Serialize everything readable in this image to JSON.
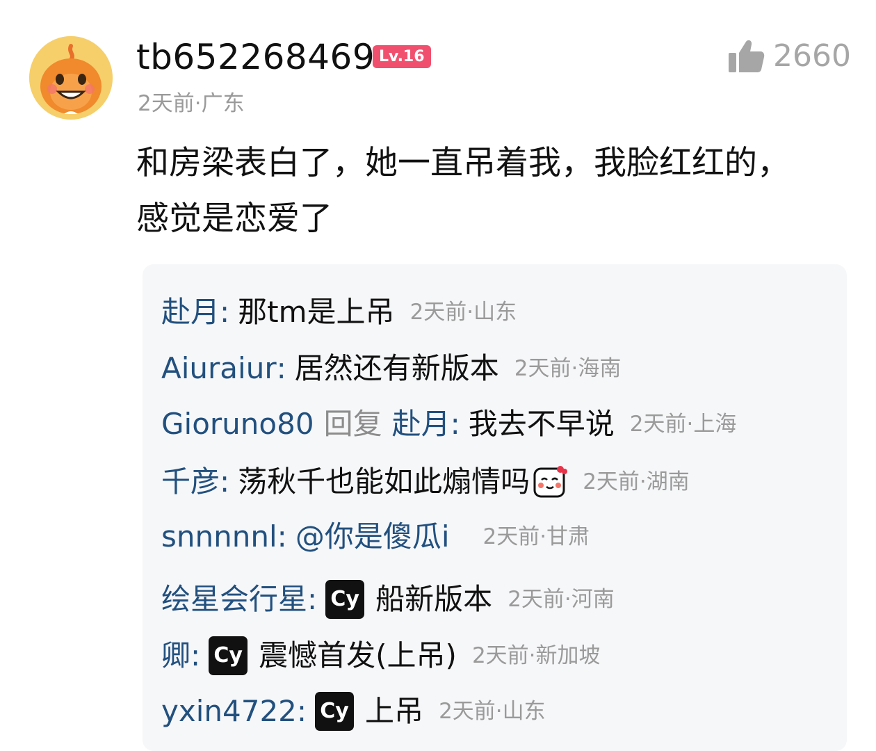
{
  "post": {
    "username": "tb652268469",
    "level": "Lv.16",
    "likes": "2660",
    "meta": "2天前·广东",
    "text": "和房梁表白了，她一直吊着我，我脸红红的，感觉是恋爱了"
  },
  "replies": [
    {
      "author": "赴月",
      "sep": ":",
      "content": "那tm是上吊",
      "meta": "2天前·山东"
    },
    {
      "author": "Aiuraiur",
      "sep": ":",
      "content": "居然还有新版本",
      "meta": "2天前·海南"
    },
    {
      "author": "Gioruno80",
      "reply_word": "回复",
      "target": "赴月",
      "sep": ":",
      "content": "我去不早说",
      "meta": "2天前·上海"
    },
    {
      "author": "千彦",
      "sep": ":",
      "content": "荡秋千也能如此煽情吗",
      "emoji": "blushing-face-icon",
      "meta": "2天前·湖南"
    },
    {
      "author": "snnnnnl",
      "sep": ":",
      "content": "@你是傻瓜i",
      "meta": "2天前·甘肃"
    },
    {
      "author": "绘星会行星",
      "sep": ":",
      "badge": "Cy",
      "content": "船新版本",
      "meta": "2天前·河南"
    },
    {
      "author": "卿",
      "sep": ":",
      "badge": "Cy",
      "content": "震憾首发(上吊)",
      "meta": "2天前·新加坡"
    },
    {
      "author": "yxin4722",
      "sep": ":",
      "badge": "Cy",
      "content": "上吊",
      "meta": "2天前·山东"
    }
  ],
  "colors": {
    "author_blue": "#22507e",
    "level_badge": "#f0506e",
    "meta_gray": "#9a9a9a",
    "avatar_bg": "#f6cf6b",
    "reply_bg": "#f6f7f9"
  }
}
